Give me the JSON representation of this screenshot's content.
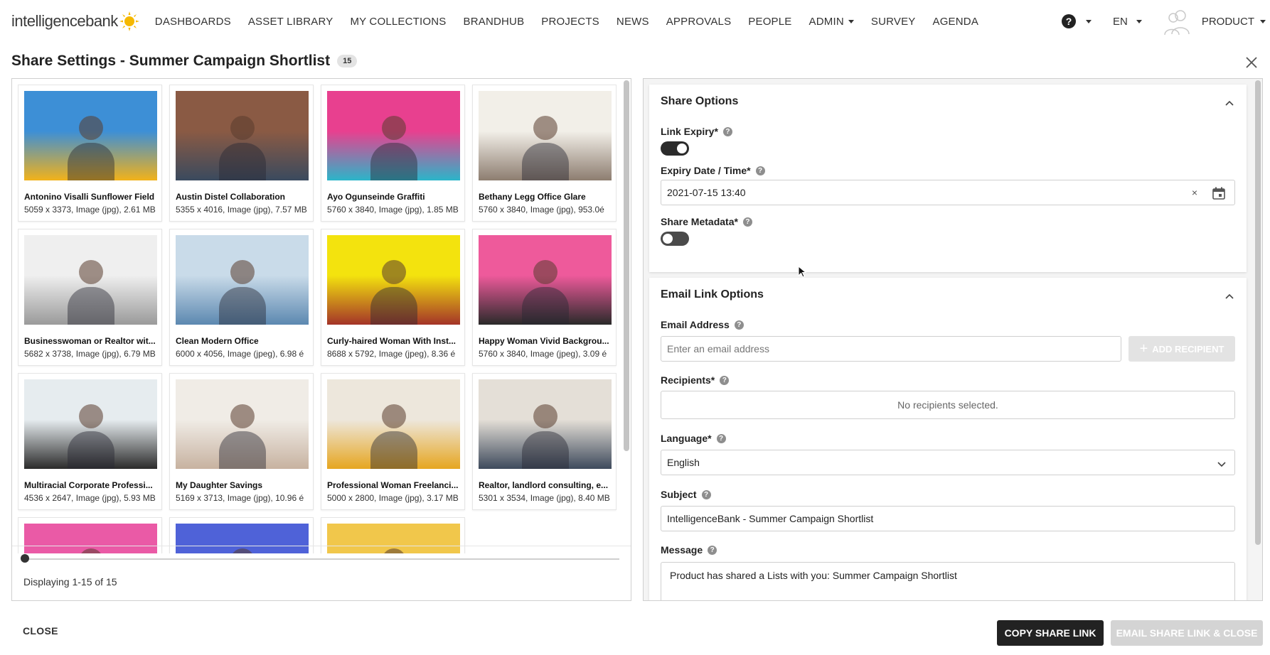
{
  "brand": {
    "logo_text_1": "intelligence",
    "logo_text_2": "bank",
    "sun_color": "#f5b800"
  },
  "nav": {
    "items": [
      {
        "label": "DASHBOARDS",
        "dropdown": false
      },
      {
        "label": "ASSET LIBRARY",
        "dropdown": false
      },
      {
        "label": "MY COLLECTIONS",
        "dropdown": false
      },
      {
        "label": "BRANDHUB",
        "dropdown": false
      },
      {
        "label": "PROJECTS",
        "dropdown": false
      },
      {
        "label": "NEWS",
        "dropdown": false
      },
      {
        "label": "APPROVALS",
        "dropdown": false
      },
      {
        "label": "PEOPLE",
        "dropdown": false
      },
      {
        "label": "ADMIN",
        "dropdown": true
      },
      {
        "label": "SURVEY",
        "dropdown": false
      },
      {
        "label": "AGENDA",
        "dropdown": false
      }
    ],
    "help_glyph": "?",
    "language": "EN",
    "user": "PRODUCT"
  },
  "page": {
    "title": "Share Settings - Summer Campaign Shortlist",
    "count": "15"
  },
  "assets": [
    {
      "name": "Antonino Visalli Sunflower Field",
      "meta": "5059 x 3373, Image (jpg), 2.61 MB",
      "colors": [
        "#3d8fd6",
        "#f2b21a"
      ]
    },
    {
      "name": "Austin Distel Collaboration",
      "meta": "5355 x 4016, Image (jpg), 7.57 MB",
      "colors": [
        "#8a5a44",
        "#3a4a5e"
      ]
    },
    {
      "name": "Ayo Ogunseinde Graffiti",
      "meta": "5760 x 3840, Image (jpg), 1.85 MB",
      "colors": [
        "#e8408f",
        "#2bb5c9"
      ]
    },
    {
      "name": "Bethany Legg Office Glare",
      "meta": "5760 x 3840, Image (jpg), 953.0é",
      "colors": [
        "#f2efe8",
        "#8d7d70"
      ]
    },
    {
      "name": "Businesswoman or Realtor wit...",
      "meta": "5682 x 3738, Image (jpg), 6.79 MB",
      "colors": [
        "#efefef",
        "#9a9a9a"
      ]
    },
    {
      "name": "Clean Modern Office",
      "meta": "6000 x 4056, Image (jpeg), 6.98 é",
      "colors": [
        "#c9dbe9",
        "#5c88b0"
      ]
    },
    {
      "name": "Curly-haired Woman With Inst...",
      "meta": "8688 x 5792, Image (jpeg), 8.36 é",
      "colors": [
        "#f3e30e",
        "#a43428"
      ]
    },
    {
      "name": "Happy Woman Vivid Backgrou...",
      "meta": "5760 x 3840, Image (jpeg), 3.09 é",
      "colors": [
        "#ee5a9b",
        "#2a2a2a"
      ]
    },
    {
      "name": "Multiracial Corporate Professi...",
      "meta": "4536 x 2647, Image (jpg), 5.93 MB",
      "colors": [
        "#e6ecef",
        "#2b2b2b"
      ]
    },
    {
      "name": "My Daughter Savings",
      "meta": "5169 x 3713, Image (jpg), 10.96 é",
      "colors": [
        "#f0ece6",
        "#c7b2a0"
      ]
    },
    {
      "name": "Professional Woman Freelanci...",
      "meta": "5000 x 2800, Image (jpg), 3.17 MB",
      "colors": [
        "#ede7dc",
        "#e6a620"
      ]
    },
    {
      "name": "Realtor, landlord consulting, e...",
      "meta": "5301 x 3534, Image (jpg), 8.40 MB",
      "colors": [
        "#e4dfd7",
        "#3e4a5c"
      ]
    },
    {
      "name": "",
      "meta": "",
      "colors": [
        "#ea5aa6",
        "#d94b3e"
      ]
    },
    {
      "name": "",
      "meta": "",
      "colors": [
        "#4f62d8",
        "#e34b8a"
      ]
    },
    {
      "name": "",
      "meta": "",
      "colors": [
        "#f1c74b",
        "#e88fb6"
      ]
    }
  ],
  "pagination": {
    "progress": 0,
    "text": "Displaying 1-15 of 15"
  },
  "share_options": {
    "title": "Share Options",
    "link_expiry_label": "Link Expiry*",
    "link_expiry_on": true,
    "expiry_label": "Expiry Date / Time*",
    "expiry_value": "2021-07-15  13:40",
    "clear_glyph": "×",
    "share_metadata_label": "Share Metadata*",
    "share_metadata_on": false
  },
  "email_options": {
    "title": "Email Link Options",
    "email_label": "Email Address",
    "email_placeholder": "Enter an email address",
    "add_recipient": "ADD RECIPIENT",
    "recipients_label": "Recipients*",
    "recipients_empty": "No recipients selected.",
    "language_label": "Language*",
    "language_value": "English",
    "subject_label": "Subject",
    "subject_value": "IntelligenceBank - Summer Campaign Shortlist",
    "message_label": "Message",
    "message_value": "Product has shared a Lists with you: Summer Campaign Shortlist"
  },
  "footer": {
    "close": "CLOSE",
    "copy_link": "COPY SHARE LINK",
    "email_link": "EMAIL SHARE LINK & CLOSE"
  },
  "colors": {
    "dark": "#222222",
    "disabled": "#d4d4d4",
    "border": "#cfcfcf"
  }
}
